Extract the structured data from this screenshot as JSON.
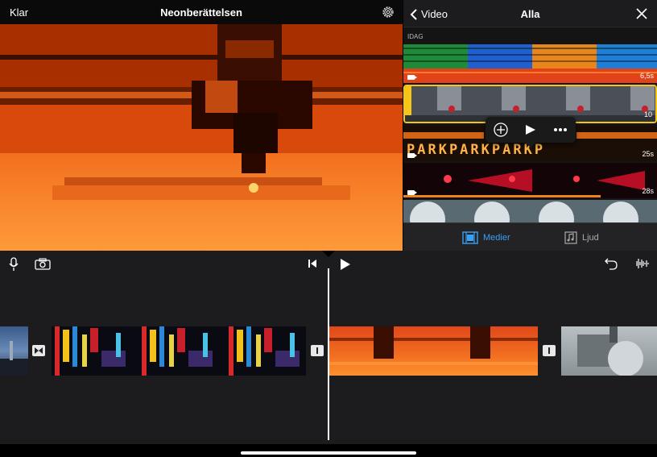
{
  "header": {
    "done_label": "Klar",
    "project_title": "Neonberättelsen"
  },
  "browser": {
    "back_label": "Video",
    "title": "Alla",
    "section_label": "IDAG",
    "clips": [
      {
        "duration": "6,5s"
      },
      {
        "duration": "10"
      },
      {
        "duration": "25s",
        "text": "PARKPARKPARKP"
      },
      {
        "duration": "28s"
      },
      {
        "duration": ""
      }
    ],
    "tabs": [
      {
        "label": "Medier",
        "active": true
      },
      {
        "label": "Ljud",
        "active": false
      }
    ],
    "accent_color": "#f5c518",
    "tab_active_color": "#3aa0f3"
  },
  "timeline": {
    "icons": [
      "microphone-icon",
      "camera-icon",
      "skip-to-start-icon",
      "play-icon",
      "undo-icon",
      "audio-waveform-icon"
    ]
  }
}
